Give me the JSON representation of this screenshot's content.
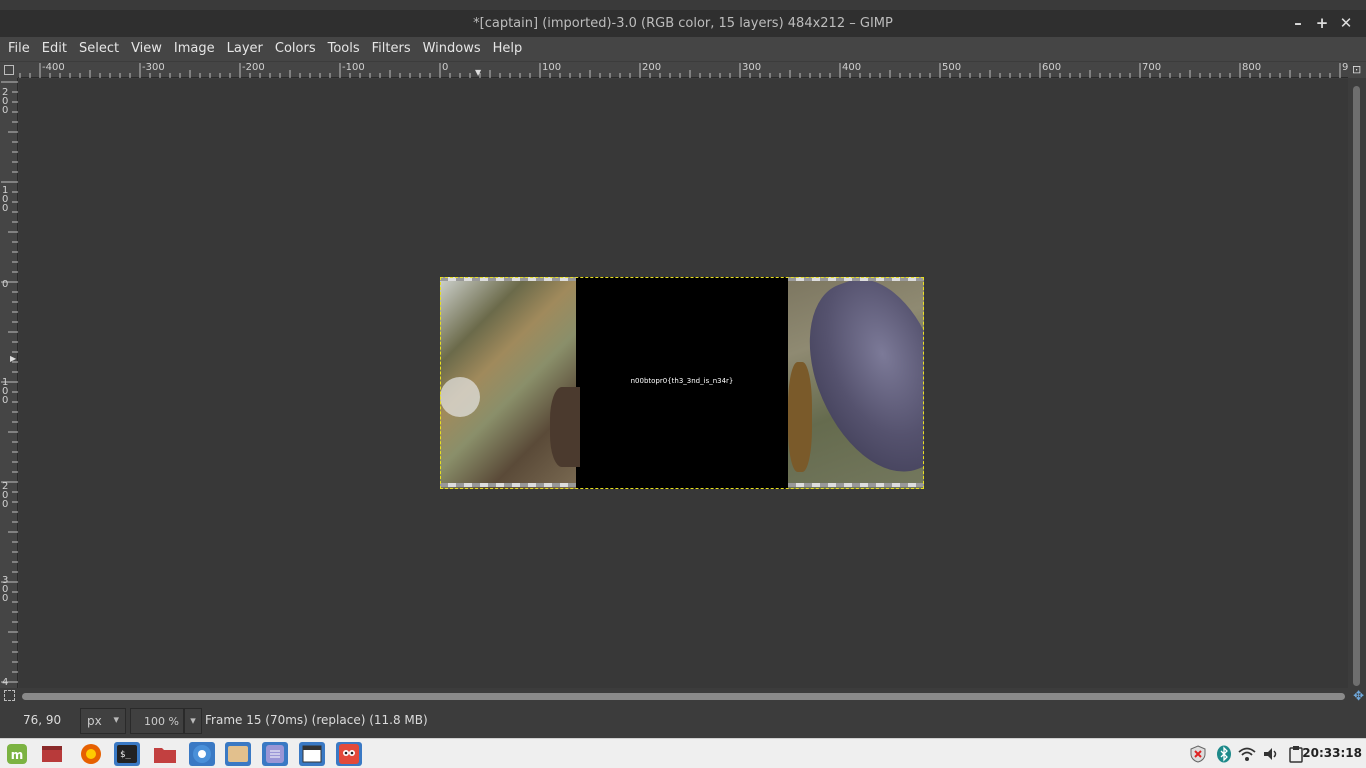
{
  "window": {
    "title": "*[captain] (imported)-3.0 (RGB color, 15 layers) 484x212 – GIMP",
    "controls": [
      "–",
      "+",
      "✕"
    ]
  },
  "menu": [
    "File",
    "Edit",
    "Select",
    "View",
    "Image",
    "Layer",
    "Colors",
    "Tools",
    "Filters",
    "Windows",
    "Help"
  ],
  "hruler_labels": [
    "-400",
    "-300",
    "-200",
    "-100",
    "0",
    "100",
    "200",
    "300",
    "400",
    "500",
    "600",
    "700",
    "800",
    "9"
  ],
  "vruler_labels": [
    "200",
    "100",
    "0",
    "100",
    "200",
    "300",
    "4"
  ],
  "canvas": {
    "hidden_text": "n00btopr0{th3_3nd_is_n34r}"
  },
  "status": {
    "coords": "76, 90",
    "unit": "px",
    "zoom": "100 %",
    "message": "Frame 15 (70ms) (replace) (11.8 MB)"
  },
  "taskbar": {
    "apps": [
      "mint-menu-icon",
      "show-desktop-icon",
      "firefox-icon",
      "terminal-icon",
      "files-icon",
      "chromium-icon",
      "file-manager-icon",
      "text-editor-icon",
      "window-icon",
      "gimp-icon"
    ],
    "clock": "20:33:18",
    "tray": [
      "security-icon",
      "bluetooth-icon",
      "wifi-icon",
      "volume-icon",
      "clipboard-icon"
    ]
  },
  "colors": {
    "selection": "#e8e020",
    "active_task": "#3a79c4",
    "mint_green": "#7cb342"
  }
}
